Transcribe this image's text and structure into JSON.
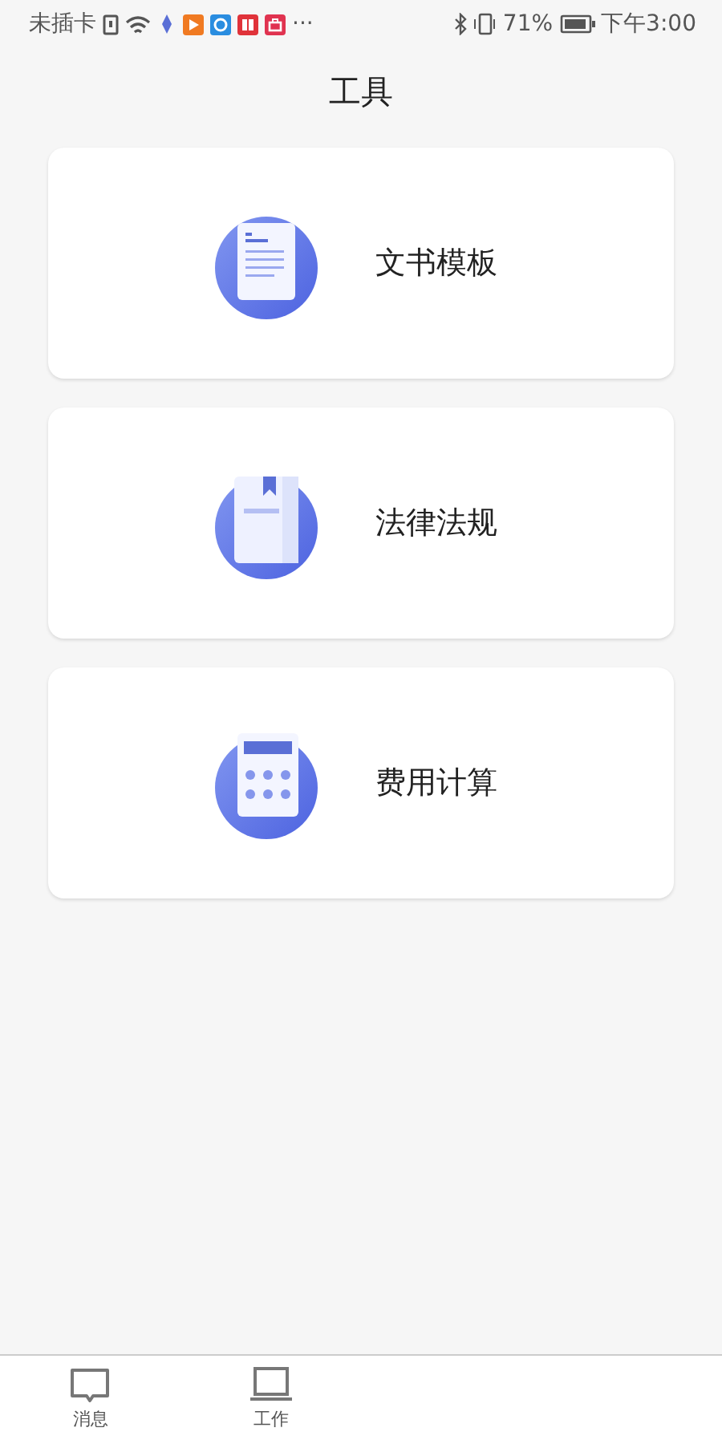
{
  "status_bar": {
    "carrier": "未插卡",
    "more": "···",
    "battery_percent": "71%",
    "time": "下午3:00"
  },
  "title": "工具",
  "tools": [
    {
      "kind": "document",
      "label": "文书模板"
    },
    {
      "kind": "book",
      "label": "法律法规"
    },
    {
      "kind": "calculator",
      "label": "费用计算"
    }
  ],
  "bottom_nav": [
    {
      "kind": "message",
      "label": "消息"
    },
    {
      "kind": "laptop",
      "label": "工作"
    }
  ]
}
